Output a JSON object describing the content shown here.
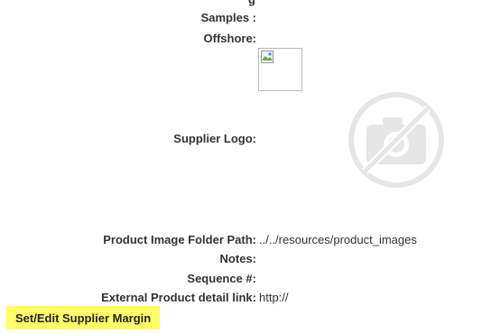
{
  "fields": {
    "samples_label": "Samples :",
    "offshore_label": "Offshore:",
    "supplier_logo_label": "Supplier Logo:",
    "image_folder_label": "Product Image Folder Path:",
    "image_folder_value": "../../resources/product_images",
    "notes_label": "Notes:",
    "sequence_label": "Sequence #:",
    "external_link_label": "External Product detail link:",
    "external_link_value": "http://"
  },
  "supplier_logo": {
    "broken_image_icon": "broken-image-icon",
    "placeholder_icon": "no-photo-camera-icon"
  },
  "actions": {
    "set_margin_label": "Set/Edit Supplier Margin"
  },
  "colors": {
    "button_background": "#ffff66",
    "label_text": "#333333",
    "placeholder_gray": "#e6e6e6"
  }
}
